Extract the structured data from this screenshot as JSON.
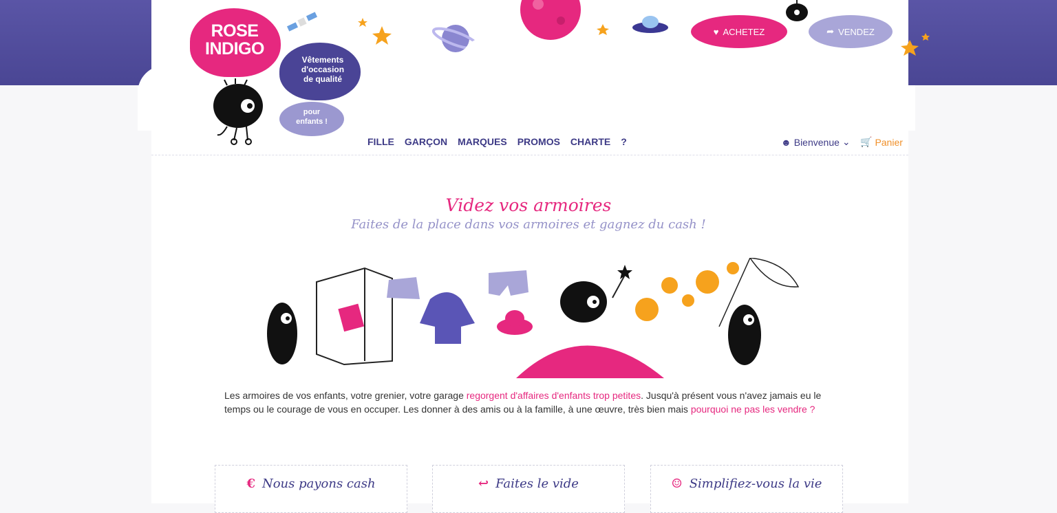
{
  "logo": {
    "line1": "ROSE",
    "line2": "INDIGO"
  },
  "tagline": {
    "line1": "Vêtements",
    "line2": "d'occasion",
    "line3": "de qualité",
    "line4": "pour",
    "line5": "enfants !"
  },
  "header": {
    "buy_label": "ACHETEZ",
    "sell_label": "VENDEZ",
    "buy_icon": "heart-icon",
    "sell_icon": "share-arrow-icon"
  },
  "nav": {
    "items": [
      "FILLE",
      "GARÇON",
      "MARQUES",
      "PROMOS",
      "CHARTE",
      "?"
    ]
  },
  "user": {
    "label": "Bienvenue",
    "icon": "user-icon"
  },
  "cart": {
    "label": "Panier",
    "icon": "cart-icon"
  },
  "hero": {
    "title": "Videz vos armoires",
    "subtitle": "Faites de la place dans vos armoires et gagnez du cash !"
  },
  "intro": {
    "part1": "Les armoires de vos enfants, votre grenier, votre garage ",
    "link1": "regorgent d'affaires d'enfants trop petites",
    "part2": ". Jusqu'à présent vous n'avez jamais eu le temps ou le courage de vous en occuper. Les donner à des amis ou à la famille, à une œuvre, très bien mais ",
    "link2": "pourquoi ne pas les vendre ?"
  },
  "features": [
    {
      "icon": "euro-icon",
      "glyph": "€",
      "label": "Nous payons cash"
    },
    {
      "icon": "reply-arrow-icon",
      "glyph": "↩",
      "label": "Faites le vide"
    },
    {
      "icon": "smiley-icon",
      "glyph": "☺",
      "label": "Simplifiez-vous la vie"
    }
  ],
  "colors": {
    "sky": "#4a4694",
    "pink": "#e6287f",
    "indigo": "#3d3a86",
    "lavender": "#9b98d0",
    "orange": "#f0902a"
  }
}
